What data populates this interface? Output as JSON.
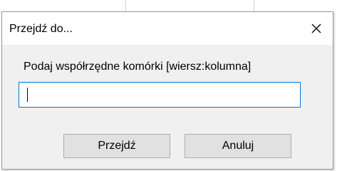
{
  "dialog": {
    "title": "Przejdź do...",
    "close_icon": "close-icon",
    "prompt": "Podaj współrzędne komórki [wiersz:kolumna]",
    "input_value": "",
    "input_placeholder": "",
    "ok_label": "Przejdź",
    "cancel_label": "Anuluj"
  },
  "colors": {
    "input_focus_border": "#0078d7",
    "dialog_background": "#f0f0f0",
    "button_background": "#e1e1e1"
  }
}
